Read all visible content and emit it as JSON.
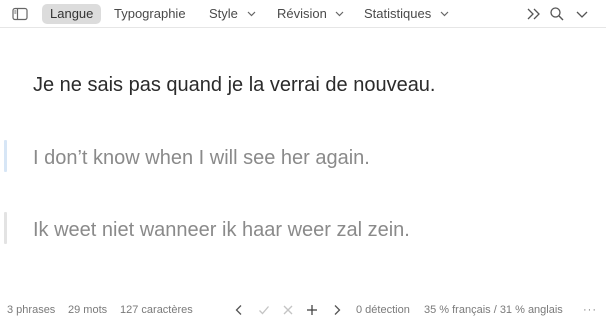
{
  "toolbar": {
    "tabs": [
      {
        "label": "Langue"
      },
      {
        "label": "Typographie"
      },
      {
        "label": "Style"
      },
      {
        "label": "Révision"
      },
      {
        "label": "Statistiques"
      }
    ],
    "active_tab": "Langue",
    "icons": [
      "sidebar-toggle-icon",
      "expand-chevrons-icon",
      "search-icon",
      "chevron-down-icon"
    ]
  },
  "content": {
    "source_sentence": "Je ne sais pas quand je la verrai de nouveau.",
    "translations": [
      {
        "text": "I don’t know when I will see her again.",
        "accent": "#d7e6f6"
      },
      {
        "text": "Ik weet niet wanneer ik haar weer zal zein.",
        "accent": "#e3e3e3"
      }
    ]
  },
  "status": {
    "phrases": "3 phrases",
    "mots": "29 mots",
    "caracteres": "127 caractères",
    "detection": "0 détection",
    "langues": "35 % français / 31 % anglais",
    "more": "···"
  }
}
